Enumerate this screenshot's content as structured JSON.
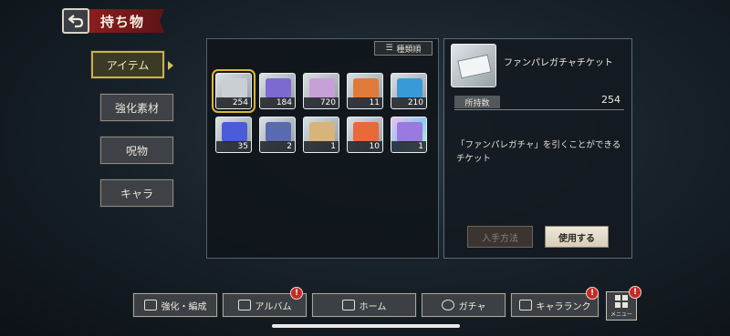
{
  "header": {
    "title": "持ち物"
  },
  "tabs": [
    {
      "label": "アイテム",
      "active": true
    },
    {
      "label": "強化素材",
      "active": false
    },
    {
      "label": "呪物",
      "active": false
    },
    {
      "label": "キャラ",
      "active": false
    }
  ],
  "inventory": {
    "sort_label": "種類順",
    "items": [
      {
        "count": "254",
        "icon": "ticket-icon",
        "color": "#c9cfd3",
        "selected": true
      },
      {
        "count": "184",
        "icon": "crystal-pouch-icon",
        "color": "#7c6ad0"
      },
      {
        "count": "720",
        "icon": "dice-icon",
        "color": "#c8a0d8"
      },
      {
        "count": "11",
        "icon": "leaves-icon",
        "color": "#e07a3a"
      },
      {
        "count": "210",
        "icon": "potion-icon",
        "color": "#3a9ad8"
      },
      {
        "count": "35",
        "icon": "card-icon",
        "color": "#4a5cd8"
      },
      {
        "count": "2",
        "icon": "pen-icon",
        "color": "#5a6ab0"
      },
      {
        "count": "1",
        "icon": "scroll-icon",
        "color": "#d8b47a"
      },
      {
        "count": "10",
        "icon": "ticket-orange-icon",
        "color": "#e86a3a"
      },
      {
        "count": "1",
        "icon": "rainbow-card-icon",
        "color": "#9a7ae0",
        "rare": true
      }
    ]
  },
  "detail": {
    "name": "ファンパレガチャチケット",
    "owned_label": "所持数",
    "owned_value": "254",
    "description": "「ファンパレガチャ」を引くことができるチケット",
    "how_to_get": "入手方法",
    "use": "使用する"
  },
  "nav": [
    {
      "label": "強化・編成",
      "icon": "enhance-icon",
      "badge": false
    },
    {
      "label": "アルバム",
      "icon": "album-icon",
      "badge": true
    },
    {
      "label": "ホーム",
      "icon": "home-icon",
      "badge": false
    },
    {
      "label": "ガチャ",
      "icon": "gacha-icon",
      "badge": false
    },
    {
      "label": "キャラランク",
      "icon": "rank-icon",
      "badge": true
    }
  ],
  "menu": {
    "label": "メニュー",
    "badge": true
  },
  "badge_symbol": "!"
}
